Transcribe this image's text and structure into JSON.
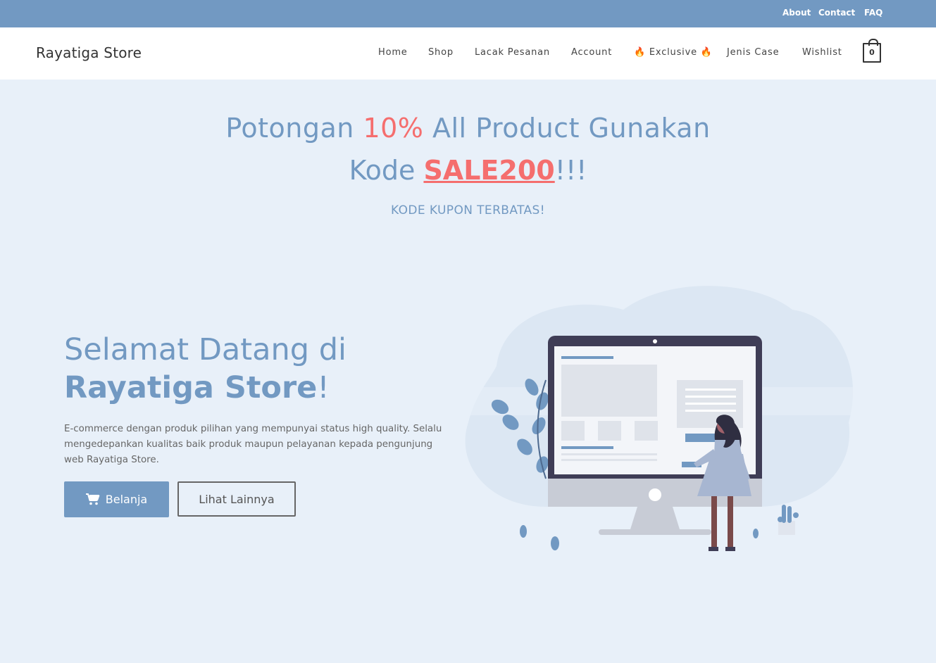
{
  "topbar": {
    "links": [
      "About",
      "Contact",
      "FAQ"
    ]
  },
  "header": {
    "brand": "Rayatiga Store",
    "nav": [
      "Home",
      "Shop",
      "Lacak Pesanan",
      "Account",
      "🔥 Exclusive 🔥",
      "Jenis Case",
      "Wishlist"
    ],
    "cart_count": "0"
  },
  "promo": {
    "line1_a": "Potongan ",
    "line1_highlight": "10%",
    "line1_b": " All Product Gunakan",
    "line2_a": "Kode ",
    "line2_code": "SALE200",
    "line2_b": "!!!",
    "subtitle": "KODE KUPON TERBATAS!"
  },
  "hero": {
    "title_a": "Selamat Datang di",
    "title_brand": "Rayatiga Store",
    "title_end": "!",
    "description": "E-commerce dengan produk pilihan yang mempunyai status high quality. Selalu mengedepankan kualitas baik produk maupun pelayanan kepada pengunjung web Rayatiga Store.",
    "primary_button": "Belanja",
    "secondary_button": "Lihat Lainnya"
  },
  "icons": {
    "cart": "shopping-cart-icon",
    "bag": "shopping-bag-icon"
  },
  "colors": {
    "accent": "#7299c2",
    "highlight": "#f56e6e",
    "background": "#e8f0f9"
  }
}
